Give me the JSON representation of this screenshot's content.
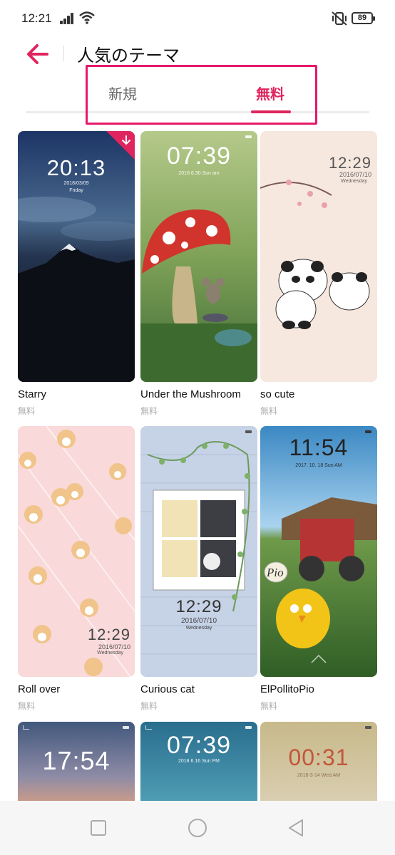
{
  "status_bar": {
    "time": "12:21",
    "battery": "89"
  },
  "header": {
    "title": "人気のテーマ"
  },
  "tabs": [
    {
      "label": "新規",
      "selected": false
    },
    {
      "label": "無料",
      "selected": true
    }
  ],
  "colors": {
    "accent": "#e0245e",
    "highlight_box": "#e6196a"
  },
  "themes": [
    {
      "name": "Starry",
      "price": "無料",
      "clock": "20:13",
      "date": "2018/03/09",
      "day": "Friday",
      "downloaded": true
    },
    {
      "name": "Under the Mushroom",
      "price": "無料",
      "clock": "07:39",
      "date": "2018 6.30 Sun am"
    },
    {
      "name": "so cute",
      "price": "無料",
      "clock": "12:29",
      "date": "2016/07/10",
      "day": "Wednesday"
    },
    {
      "name": "Roll over",
      "price": "無料",
      "clock": "12:29",
      "date": "2016/07/10",
      "day": "Wednesday"
    },
    {
      "name": "Curious cat",
      "price": "無料",
      "clock": "12:29",
      "date": "2016/07/10",
      "day": "Wednesday"
    },
    {
      "name": "ElPollitoPio",
      "price": "無料",
      "clock": "11:54",
      "date": "2017. 10. 18  Sun AM",
      "badge": "Pio"
    },
    {
      "clock": "17:54"
    },
    {
      "clock": "07:39",
      "date": "2018 6.16 Sun PM"
    },
    {
      "clock": "00:31",
      "date": "2018-3-14 Wed AM"
    }
  ],
  "icons": {
    "back": "arrow-left-icon",
    "download": "download-icon",
    "nav_recent": "square-icon",
    "nav_home": "circle-icon",
    "nav_back": "triangle-icon"
  }
}
